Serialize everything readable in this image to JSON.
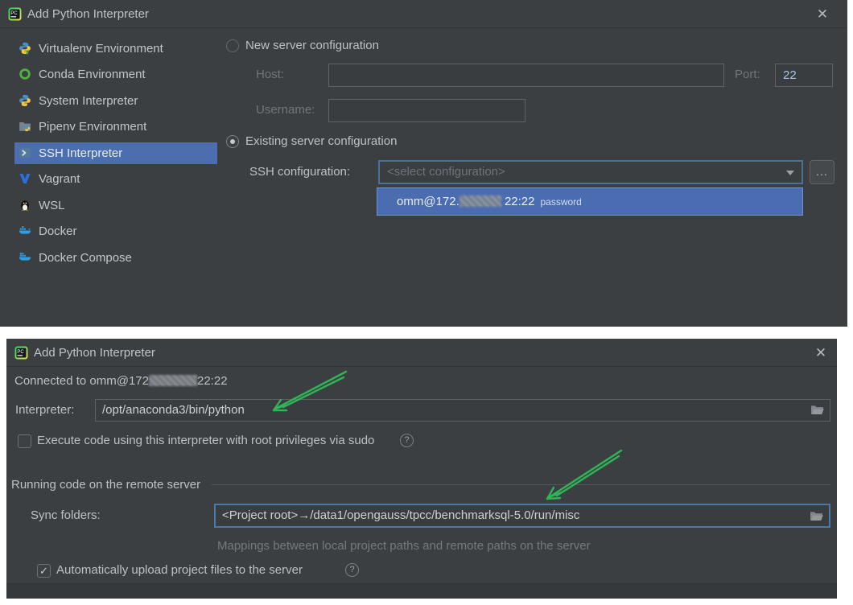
{
  "colors": {
    "dialog_bg": "#3c3f41",
    "selection_blue": "#4b6eaf",
    "focus_border_blue": "#4a79ad",
    "annotation_green": "#2fb457"
  },
  "glyphs": {
    "close": "✕",
    "more": "...",
    "help": "?",
    "check": "✓"
  },
  "dialog_top": {
    "title": "Add Python Interpreter",
    "sidebar": {
      "selected": "SSH Interpreter",
      "items": [
        {
          "label": "Virtualenv Environment",
          "icon": "python-virtualenv-icon"
        },
        {
          "label": "Conda Environment",
          "icon": "conda-icon"
        },
        {
          "label": "System Interpreter",
          "icon": "python-icon"
        },
        {
          "label": "Pipenv Environment",
          "icon": "pipenv-folder-icon"
        },
        {
          "label": "SSH Interpreter",
          "icon": "ssh-terminal-icon"
        },
        {
          "label": "Vagrant",
          "icon": "vagrant-icon"
        },
        {
          "label": "WSL",
          "icon": "linux-penguin-icon"
        },
        {
          "label": "Docker",
          "icon": "docker-whale-icon"
        },
        {
          "label": "Docker Compose",
          "icon": "docker-compose-icon"
        }
      ]
    },
    "form": {
      "radio_new_label": "New server configuration",
      "host_label": "Host:",
      "port_label": "Port:",
      "port_value": "22",
      "username_label": "Username:",
      "radio_existing_label": "Existing server configuration",
      "ssh_config_label": "SSH configuration:",
      "ssh_config_placeholder": "<select configuration>",
      "dropdown_option": {
        "user_host_prefix": "omm@172.",
        "port_suffix": "22:22",
        "auth_type": "password"
      }
    }
  },
  "dialog_bottom": {
    "title": "Add Python Interpreter",
    "connected_prefix": "Connected to omm@172",
    "connected_suffix": "22:22",
    "interpreter_label": "Interpreter:",
    "interpreter_value": "/opt/anaconda3/bin/python",
    "sudo_checkbox_label": "Execute code using this interpreter with root privileges via sudo",
    "section_header": "Running code on the remote server",
    "sync_label": "Sync folders:",
    "sync_value": "<Project root>→/data1/opengauss/tpcc/benchmarksql-5.0/run/misc",
    "sync_hint": "Mappings between local project paths and remote paths on the server",
    "upload_checkbox_label": "Automatically upload project files to the server"
  }
}
